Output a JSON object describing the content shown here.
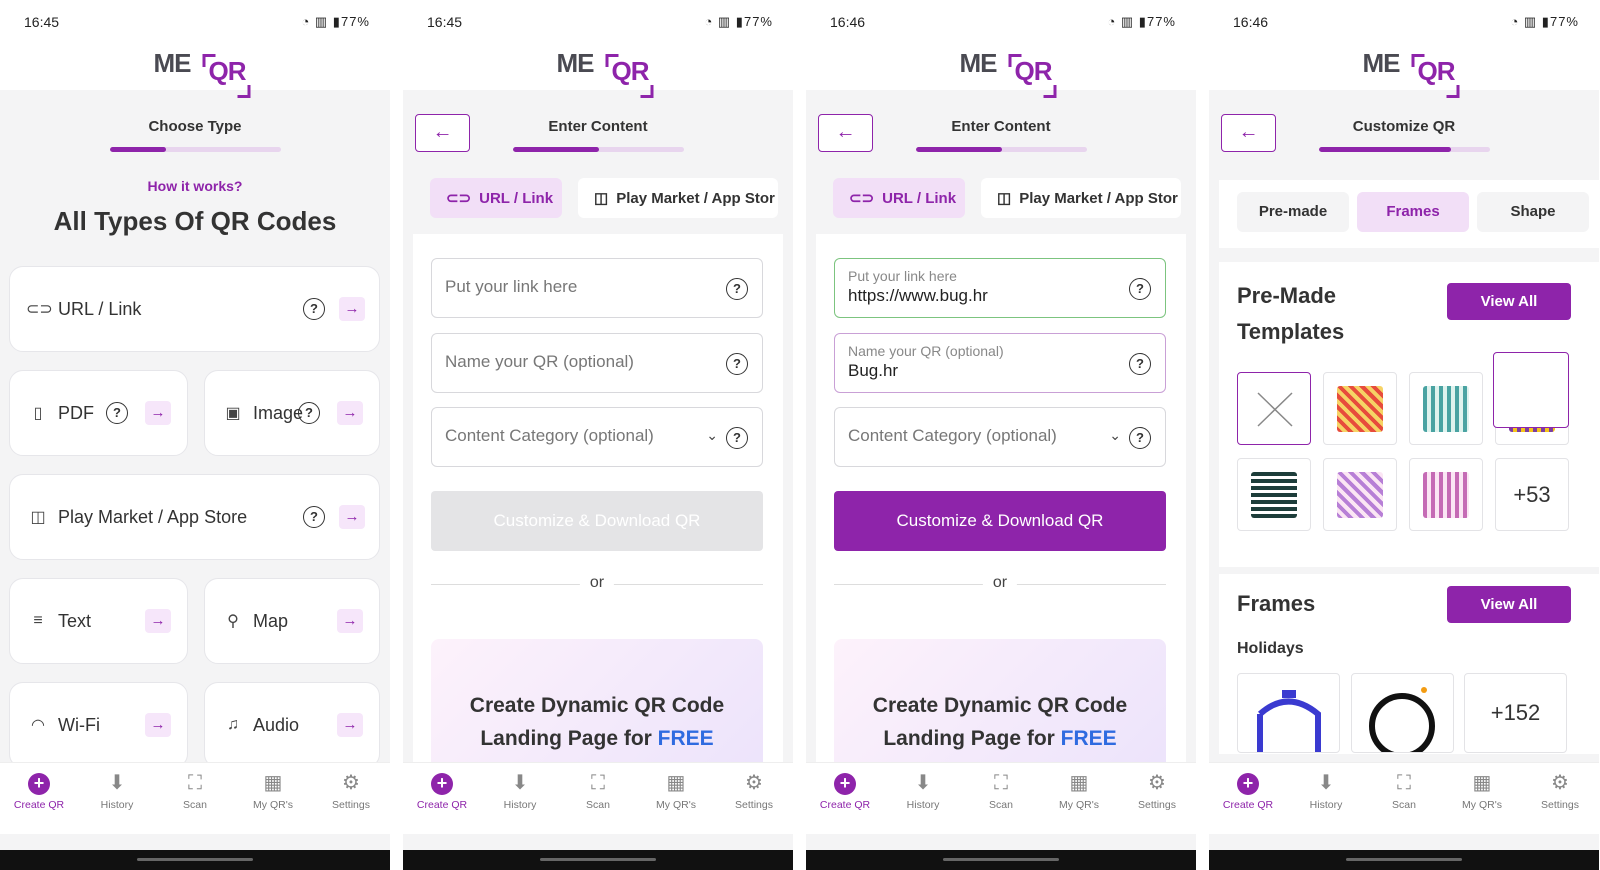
{
  "statusbar": {
    "s1_time": "16:45",
    "s2_time": "16:45",
    "s3_time": "16:46",
    "s4_time": "16:46",
    "battery": "77%"
  },
  "logo": {
    "me": "ME",
    "qr": "QR"
  },
  "screen1": {
    "step_title": "Choose Type",
    "progress": 0.33,
    "how_link": "How it works?",
    "title": "All Types Of QR Codes",
    "types": [
      {
        "label": "URL / Link",
        "icon": "link-icon",
        "help": true
      },
      {
        "label": "PDF",
        "icon": "pdf-icon",
        "help": true
      },
      {
        "label": "Image",
        "icon": "image-icon",
        "help": true
      },
      {
        "label": "Play Market / App Store",
        "icon": "app-icon",
        "help": true
      },
      {
        "label": "Text",
        "icon": "text-icon",
        "help": false
      },
      {
        "label": "Map",
        "icon": "map-icon",
        "help": false
      },
      {
        "label": "Wi-Fi",
        "icon": "wifi-icon",
        "help": false
      },
      {
        "label": "Audio",
        "icon": "audio-icon",
        "help": false
      }
    ]
  },
  "screen2": {
    "step_title": "Enter Content",
    "progress": 0.5,
    "chip_url": "URL / Link",
    "chip_play": "Play Market / App Stor",
    "link_placeholder": "Put your link here",
    "name_placeholder": "Name your QR (optional)",
    "category_placeholder": "Content Category (optional)",
    "cta": "Customize & Download QR",
    "or": "or",
    "promo_line1": "Create Dynamic QR Code",
    "promo_line2": "Landing Page for",
    "promo_free": "FREE"
  },
  "screen3": {
    "step_title": "Enter Content",
    "progress": 0.5,
    "chip_url": "URL / Link",
    "chip_play": "Play Market / App Stor",
    "link_label": "Put your link here",
    "link_value": "https://www.bug.hr",
    "name_label": "Name your QR (optional)",
    "name_value": "Bug.hr",
    "category_placeholder": "Content Category (optional)",
    "cta": "Customize & Download QR",
    "or": "or",
    "promo_line1": "Create Dynamic QR Code",
    "promo_line2": "Landing Page for",
    "promo_free": "FREE"
  },
  "screen4": {
    "step_title": "Customize QR",
    "progress": 0.77,
    "tabs": [
      "Pre-made",
      "Frames",
      "Shape"
    ],
    "active_tab": "Frames",
    "premade_title_1": "Pre-Made",
    "premade_title_2": "Templates",
    "view_all": "View All",
    "premade_more": "+53",
    "frames_title": "Frames",
    "holidays": "Holidays",
    "frames_more": "+152"
  },
  "nav": [
    "Create QR",
    "History",
    "Scan",
    "My QR's",
    "Settings"
  ],
  "colors": {
    "accent": "#8e24aa",
    "accent_light": "#f2dff7",
    "free": "#2f6be0"
  }
}
